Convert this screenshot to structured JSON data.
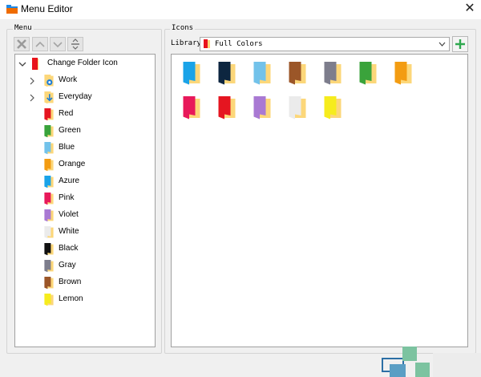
{
  "window": {
    "title": "Menu Editor",
    "close_glyph": "✕"
  },
  "menu": {
    "label": "Menu",
    "toolbar": [
      "delete-icon",
      "move-up-icon",
      "move-down-icon",
      "separator-icon"
    ],
    "root": {
      "label": "Change Folder Icon",
      "color": "#e8141c"
    },
    "items": [
      {
        "label": "Work",
        "icon": "gear-folder-icon",
        "expandable": true
      },
      {
        "label": "Everyday",
        "icon": "download-folder-icon",
        "expandable": true
      },
      {
        "label": "Red",
        "color": "#e51520"
      },
      {
        "label": "Green",
        "color": "#3aa33b"
      },
      {
        "label": "Blue",
        "color": "#72c2ea"
      },
      {
        "label": "Orange",
        "color": "#f39c12"
      },
      {
        "label": "Azure",
        "color": "#1aa3e8"
      },
      {
        "label": "Pink",
        "color": "#e8195a"
      },
      {
        "label": "Violet",
        "color": "#a979d3"
      },
      {
        "label": "White",
        "color": "#ebebeb"
      },
      {
        "label": "Black",
        "color": "#111111"
      },
      {
        "label": "Gray",
        "color": "#7d7d8c"
      },
      {
        "label": "Brown",
        "color": "#9b5628"
      },
      {
        "label": "Lemon",
        "color": "#f6ec1d"
      }
    ]
  },
  "icons_panel": {
    "label": "Icons",
    "library_label": "Library",
    "library_value": "Full Colors",
    "library_color": "#e8141c",
    "add_icon": "plus-icon",
    "colors": [
      "#1aa3e8",
      "#0d2640",
      "#72c2ea",
      "#9b5628",
      "#7d7d8c",
      "#3aa33b",
      "#f39c12",
      "#e8195a",
      "#e51520",
      "#a979d3",
      "#ebebeb",
      "#f6ec1d"
    ]
  }
}
